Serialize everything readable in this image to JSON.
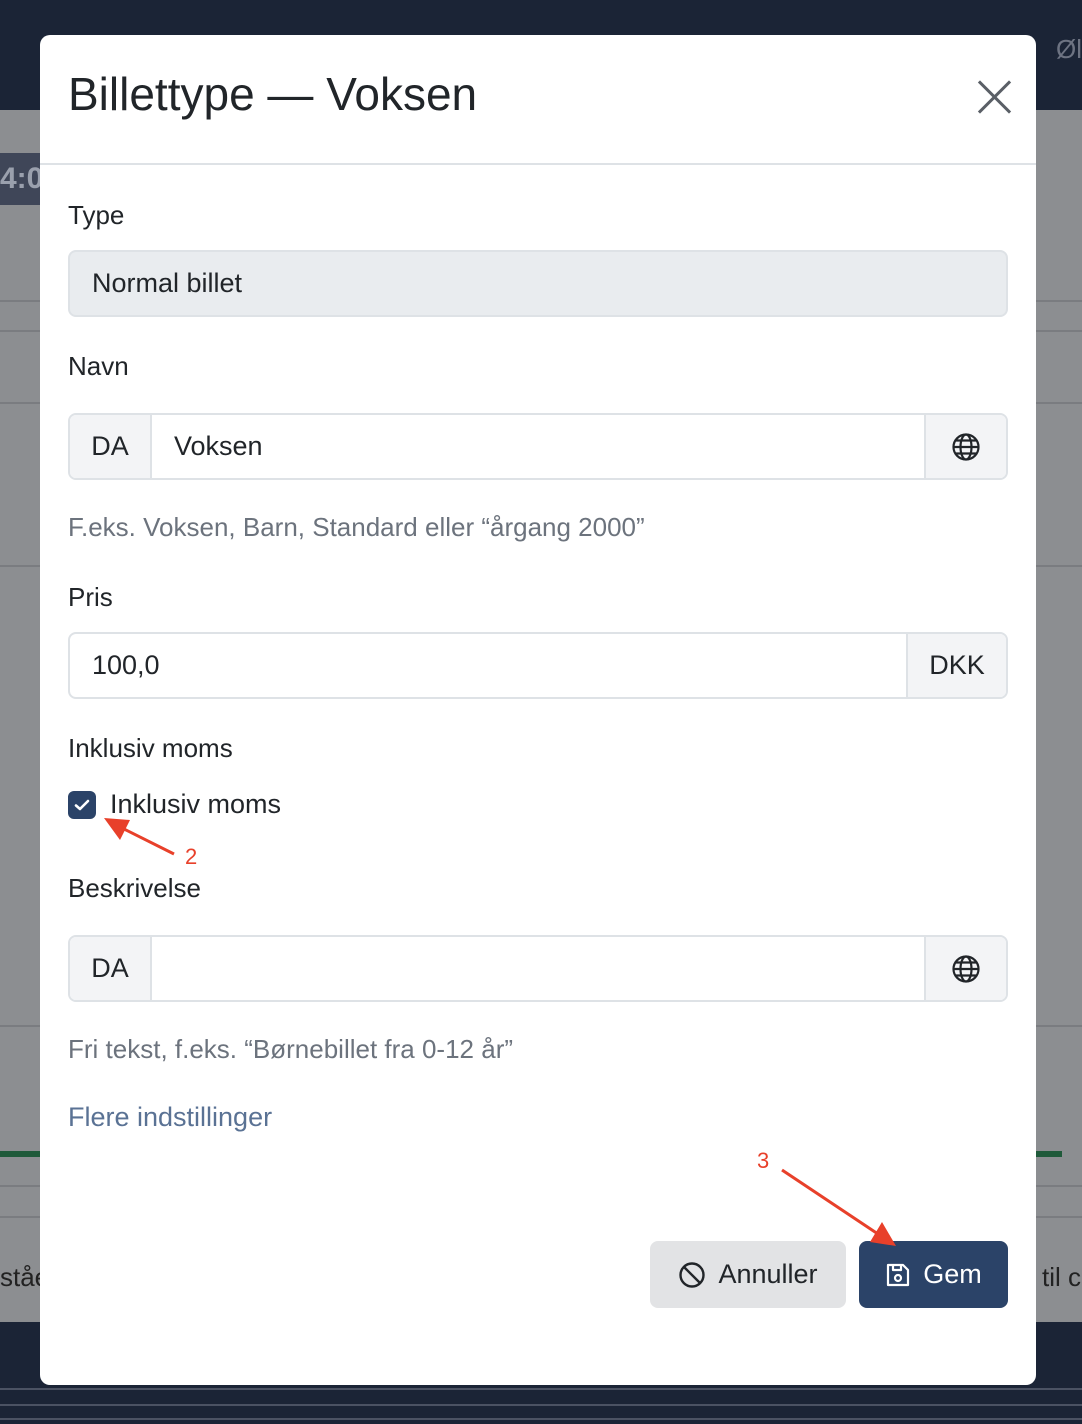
{
  "background": {
    "top_right_text": "Øl",
    "time_fragment": "4:0",
    "bottom_left_text": "ståe",
    "bottom_right_text": "til c"
  },
  "modal": {
    "title": "Billettype — Voksen",
    "type": {
      "label": "Type",
      "value": "Normal billet"
    },
    "name": {
      "label": "Navn",
      "lang": "DA",
      "value": "Voksen",
      "hint": "F.eks. Voksen, Barn, Standard eller “årgang 2000”"
    },
    "price": {
      "label": "Pris",
      "value": "100,0",
      "currency": "DKK"
    },
    "vat": {
      "label": "Inklusiv moms",
      "checkbox_label": "Inklusiv moms",
      "checked": true
    },
    "description": {
      "label": "Beskrivelse",
      "lang": "DA",
      "value": "",
      "hint": "Fri tekst, f.eks. “Børnebillet fra 0-12 år”"
    },
    "more_settings": "Flere indstillinger",
    "cancel_label": "Annuller",
    "save_label": "Gem"
  },
  "annotations": {
    "marker_2": "2",
    "marker_3": "3",
    "color": "#e8402a"
  },
  "colors": {
    "primary": "#2b4368",
    "topbar": "#1b2436",
    "link": "#5a7294"
  }
}
